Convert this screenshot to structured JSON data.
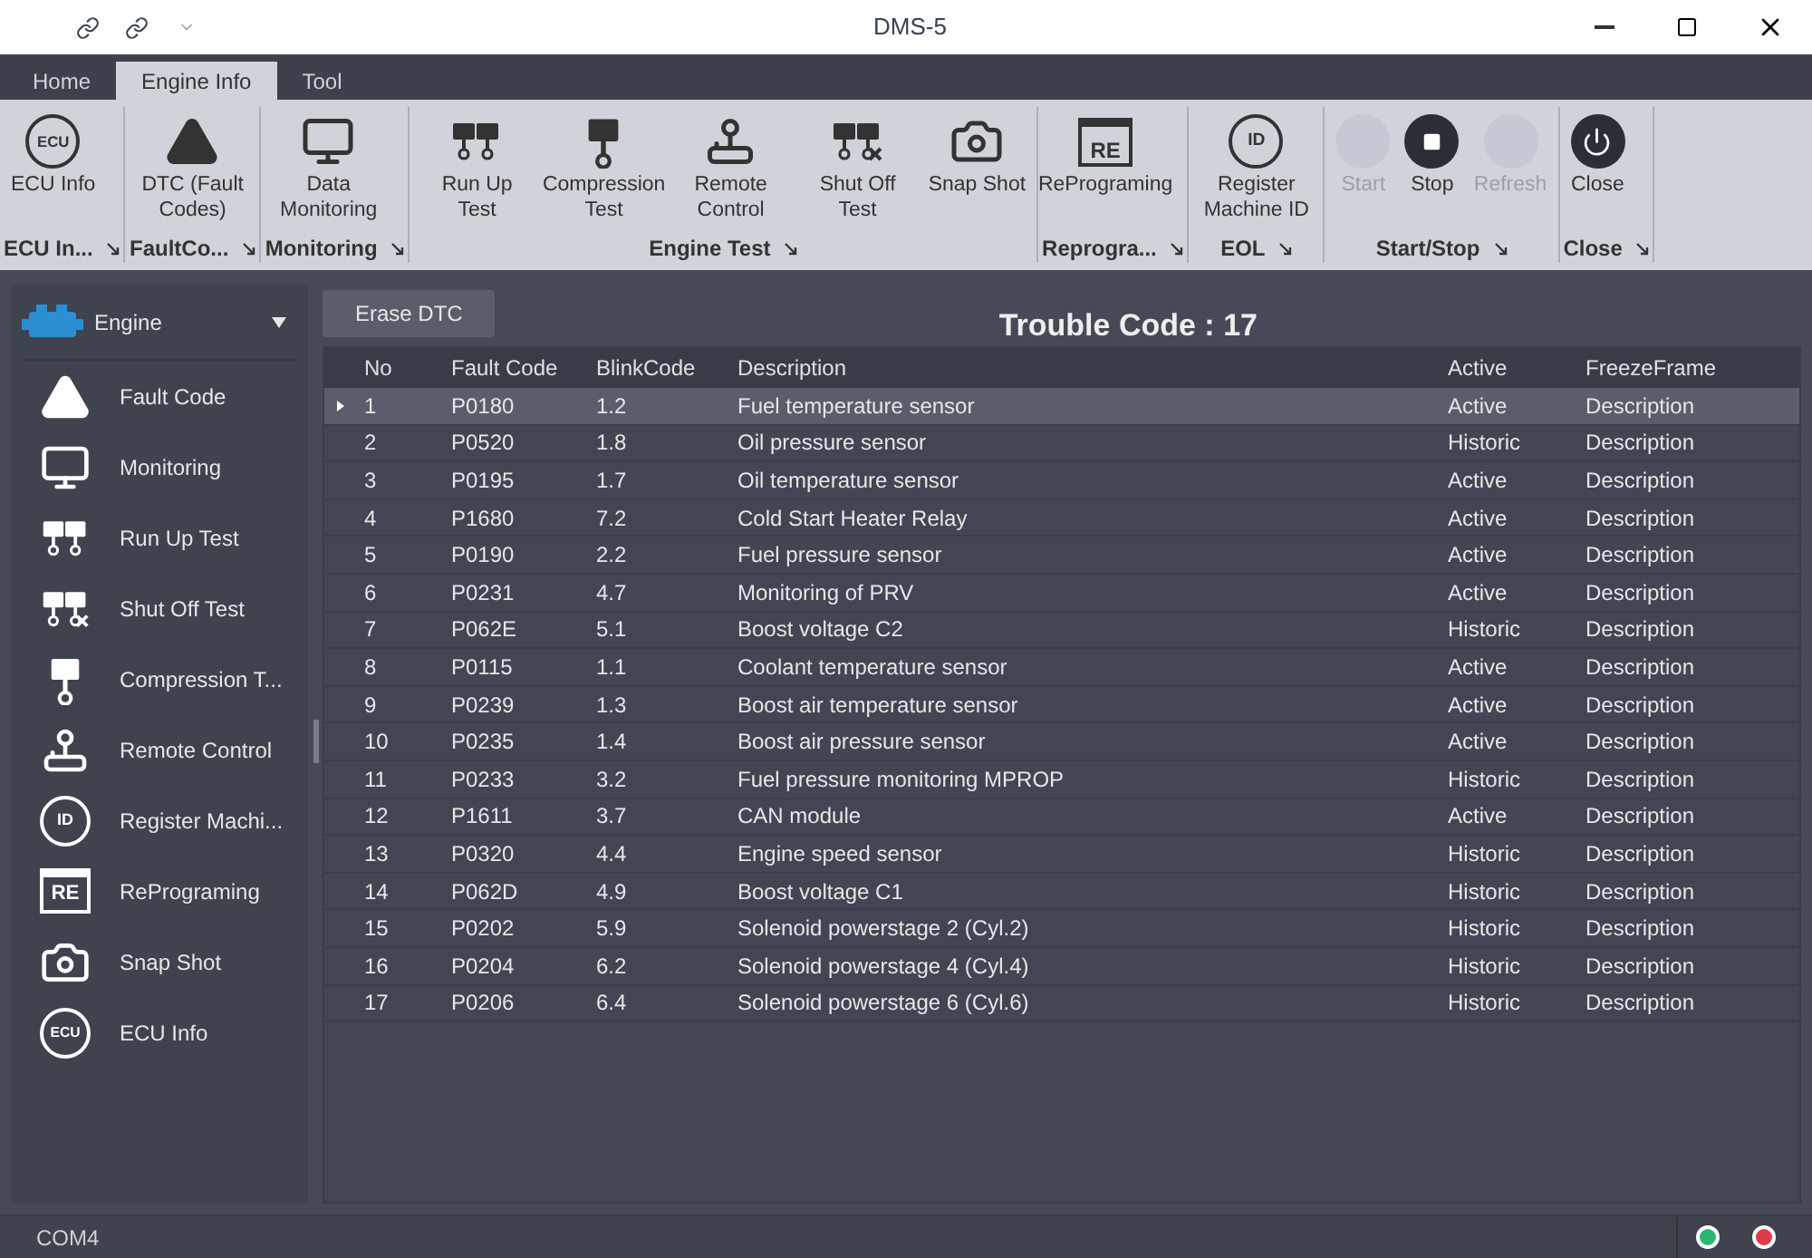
{
  "window": {
    "title": "DMS-5"
  },
  "tabs": [
    {
      "label": "Home",
      "selected": false
    },
    {
      "label": "Engine Info",
      "selected": true
    },
    {
      "label": "Tool",
      "selected": false
    }
  ],
  "ribbon": [
    {
      "label": "ECU In...",
      "launcher": true,
      "buttons": [
        {
          "label": "ECU Info",
          "kind": "ecu",
          "badge": "ECU",
          "disabled": false
        }
      ]
    },
    {
      "label": "FaultCo...",
      "launcher": true,
      "buttons": [
        {
          "label": "DTC (Fault Codes)",
          "kind": "warning",
          "disabled": false
        }
      ]
    },
    {
      "label": "Monitoring",
      "launcher": true,
      "buttons": [
        {
          "label": "Data Monitoring",
          "kind": "monitor",
          "disabled": false
        }
      ]
    },
    {
      "label": "Engine Test",
      "launcher": true,
      "buttons": [
        {
          "label": "Run Up Test",
          "kind": "pistons",
          "disabled": false
        },
        {
          "label": "Compression Test",
          "kind": "piston",
          "disabled": false
        },
        {
          "label": "Remote Control",
          "kind": "joystick",
          "disabled": false
        },
        {
          "label": "Shut Off Test",
          "kind": "pistons-x",
          "disabled": false
        },
        {
          "label": "Snap Shot",
          "kind": "camera",
          "disabled": false
        }
      ]
    },
    {
      "label": "Reprogra...",
      "launcher": true,
      "buttons": [
        {
          "label": "RePrograming",
          "kind": "re",
          "badge": "RE",
          "disabled": false
        }
      ]
    },
    {
      "label": "EOL",
      "launcher": true,
      "buttons": [
        {
          "label": "Register Machine ID",
          "kind": "id",
          "badge": "ID",
          "disabled": false
        }
      ]
    },
    {
      "label": "Start/Stop",
      "launcher": true,
      "buttons": [
        {
          "label": "Start",
          "kind": "blank",
          "disabled": true
        },
        {
          "label": "Stop",
          "kind": "stop",
          "disabled": false
        },
        {
          "label": "Refresh",
          "kind": "blank",
          "disabled": true
        }
      ]
    },
    {
      "label": "Close",
      "launcher": true,
      "buttons": [
        {
          "label": "Close",
          "kind": "power",
          "disabled": false
        }
      ]
    }
  ],
  "sidebar": {
    "selector": "Engine",
    "items": [
      {
        "label": "Fault Code",
        "kind": "warning"
      },
      {
        "label": "Monitoring",
        "kind": "monitor"
      },
      {
        "label": "Run Up Test",
        "kind": "pistons"
      },
      {
        "label": "Shut Off Test",
        "kind": "pistons-x"
      },
      {
        "label": "Compression T...",
        "kind": "piston"
      },
      {
        "label": "Remote Control",
        "kind": "joystick"
      },
      {
        "label": "Register Machi...",
        "kind": "id",
        "badge": "ID"
      },
      {
        "label": "RePrograming",
        "kind": "re",
        "badge": "RE"
      },
      {
        "label": "Snap Shot",
        "kind": "camera"
      },
      {
        "label": "ECU Info",
        "kind": "ecu",
        "badge": "ECU"
      }
    ]
  },
  "erase_button": "Erase DTC",
  "trouble_code": "Trouble Code : 17",
  "table": {
    "columns": [
      "No",
      "Fault Code",
      "BlinkCode",
      "Description",
      "Active",
      "FreezeFrame"
    ],
    "rows": [
      {
        "cells": [
          "1",
          "P0180",
          "1.2",
          "Fuel temperature sensor",
          "Active",
          "Description"
        ],
        "selected": true
      },
      {
        "cells": [
          "2",
          "P0520",
          "1.8",
          "Oil pressure sensor",
          "Historic",
          "Description"
        ],
        "selected": false
      },
      {
        "cells": [
          "3",
          "P0195",
          "1.7",
          "Oil temperature sensor",
          "Active",
          "Description"
        ],
        "selected": false
      },
      {
        "cells": [
          "4",
          "P1680",
          "7.2",
          "Cold Start Heater Relay",
          "Active",
          "Description"
        ],
        "selected": false
      },
      {
        "cells": [
          "5",
          "P0190",
          "2.2",
          "Fuel pressure sensor",
          "Active",
          "Description"
        ],
        "selected": false
      },
      {
        "cells": [
          "6",
          "P0231",
          "4.7",
          "Monitoring of PRV",
          "Active",
          "Description"
        ],
        "selected": false
      },
      {
        "cells": [
          "7",
          "P062E",
          "5.1",
          "Boost voltage C2",
          "Historic",
          "Description"
        ],
        "selected": false
      },
      {
        "cells": [
          "8",
          "P0115",
          "1.1",
          "Coolant temperature sensor",
          "Active",
          "Description"
        ],
        "selected": false
      },
      {
        "cells": [
          "9",
          "P0239",
          "1.3",
          "Boost air temperature sensor",
          "Active",
          "Description"
        ],
        "selected": false
      },
      {
        "cells": [
          "10",
          "P0235",
          "1.4",
          "Boost air pressure sensor",
          "Active",
          "Description"
        ],
        "selected": false
      },
      {
        "cells": [
          "11",
          "P0233",
          "3.2",
          "Fuel pressure monitoring MPROP",
          "Historic",
          "Description"
        ],
        "selected": false
      },
      {
        "cells": [
          "12",
          "P1611",
          "3.7",
          "CAN module",
          "Active",
          "Description"
        ],
        "selected": false
      },
      {
        "cells": [
          "13",
          "P0320",
          "4.4",
          "Engine speed sensor",
          "Historic",
          "Description"
        ],
        "selected": false
      },
      {
        "cells": [
          "14",
          "P062D",
          "4.9",
          "Boost voltage C1",
          "Historic",
          "Description"
        ],
        "selected": false
      },
      {
        "cells": [
          "15",
          "P0202",
          "5.9",
          "Solenoid powerstage 2 (Cyl.2)",
          "Historic",
          "Description"
        ],
        "selected": false
      },
      {
        "cells": [
          "16",
          "P0204",
          "6.2",
          "Solenoid powerstage 4 (Cyl.4)",
          "Historic",
          "Description"
        ],
        "selected": false
      },
      {
        "cells": [
          "17",
          "P0206",
          "6.4",
          "Solenoid powerstage 6 (Cyl.6)",
          "Historic",
          "Description"
        ],
        "selected": false
      }
    ]
  },
  "status_bar": {
    "port": "COM4",
    "lights": [
      {
        "color": "#2bb673"
      },
      {
        "color": "#e0394a"
      }
    ]
  }
}
